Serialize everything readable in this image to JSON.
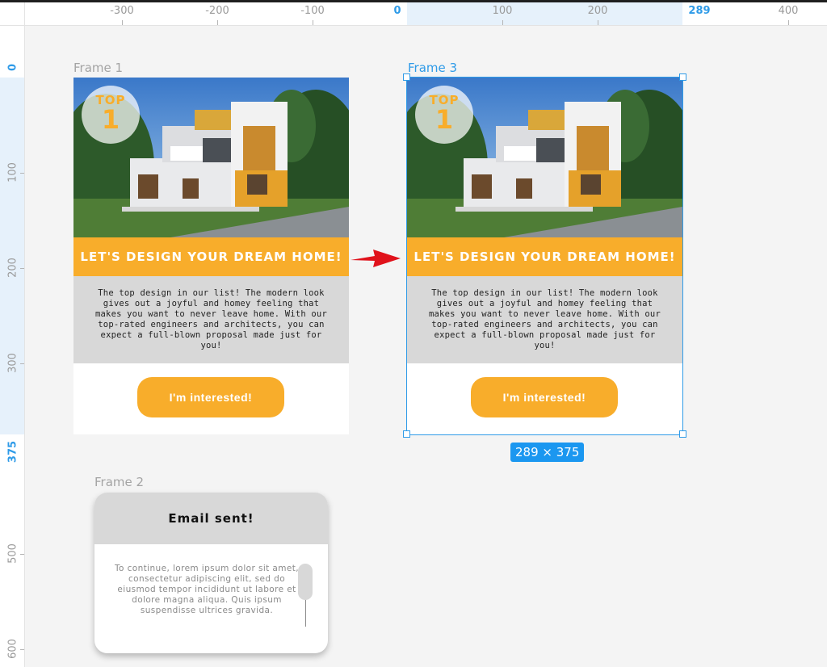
{
  "ruler": {
    "h": [
      {
        "label": "-300",
        "accent": false
      },
      {
        "label": "-200",
        "accent": false
      },
      {
        "label": "-100",
        "accent": false
      },
      {
        "label": "0",
        "accent": true
      },
      {
        "label": "100",
        "accent": false
      },
      {
        "label": "200",
        "accent": false
      },
      {
        "label": "289",
        "accent": true
      },
      {
        "label": "400",
        "accent": false
      }
    ],
    "v": [
      {
        "label": "0",
        "accent": true
      },
      {
        "label": "100",
        "accent": false
      },
      {
        "label": "200",
        "accent": false
      },
      {
        "label": "300",
        "accent": false
      },
      {
        "label": "375",
        "accent": true
      },
      {
        "label": "500",
        "accent": false
      },
      {
        "label": "600",
        "accent": false
      }
    ]
  },
  "frames": {
    "frame1": {
      "label": "Frame 1"
    },
    "frame2": {
      "label": "Frame 2"
    },
    "frame3": {
      "label": "Frame 3"
    }
  },
  "card": {
    "badge_top": "TOP",
    "badge_rank": "1",
    "banner": "LET'S DESIGN YOUR DREAM HOME!",
    "description": "The top design in our list! The modern look gives out a joyful and homey feeling that makes you want to never leave home. With our top-rated engineers and architects, you can expect a full-blown proposal made just for you!",
    "cta": "I'm interested!"
  },
  "modal": {
    "title": "Email sent!",
    "body": "To continue, lorem ipsum dolor sit amet, consectetur adipiscing elit, sed do eiusmod tempor incididunt ut labore et dolore magna aliqua. Quis ipsum suspendisse ultrices gravida."
  },
  "selection": {
    "size_label": "289 × 375"
  },
  "colors": {
    "accent": "#f8ad2b",
    "selection": "#2f9be8",
    "arrow": "#e0121b"
  },
  "icons": {
    "arrow": "arrow-right-icon"
  }
}
